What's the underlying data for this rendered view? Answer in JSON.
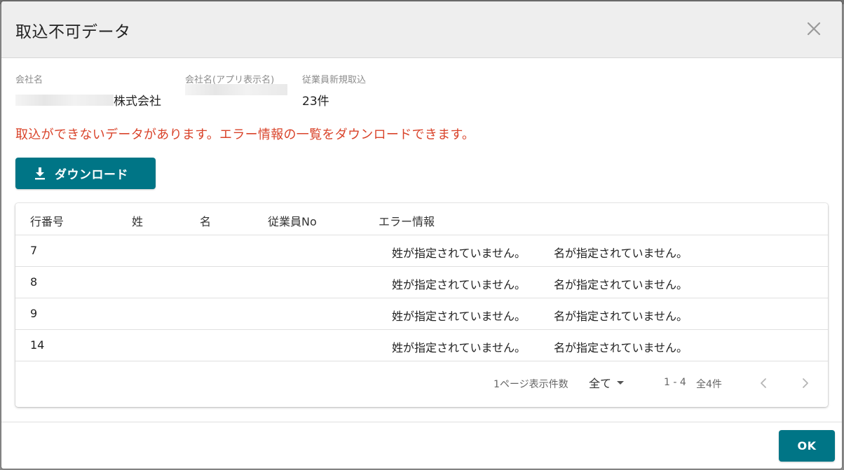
{
  "dialog": {
    "title": "取込不可データ",
    "close_icon": "close-icon"
  },
  "summary": {
    "company_name_label": "会社名",
    "company_name_suffix": "株式会社",
    "company_app_name_label": "会社名(アプリ表示名)",
    "new_employee_label": "従業員新規取込",
    "new_employee_value": "23件"
  },
  "error_message": "取込ができないデータがあります。エラー情報の一覧をダウンロードできます。",
  "download_button": {
    "label": "ダウンロード",
    "icon": "download-icon"
  },
  "table": {
    "columns": [
      "行番号",
      "姓",
      "名",
      "従業員No",
      "エラー情報"
    ],
    "rows": [
      {
        "row_no": "7",
        "last_name": "",
        "first_name": "",
        "employee_no": "",
        "error_1": "姓が指定されていません。",
        "error_2": "名が指定されていません。"
      },
      {
        "row_no": "8",
        "last_name": "",
        "first_name": "",
        "employee_no": "",
        "error_1": "姓が指定されていません。",
        "error_2": "名が指定されていません。"
      },
      {
        "row_no": "9",
        "last_name": "",
        "first_name": "",
        "employee_no": "",
        "error_1": "姓が指定されていません。",
        "error_2": "名が指定されていません。"
      },
      {
        "row_no": "14",
        "last_name": "",
        "first_name": "",
        "employee_no": "",
        "error_1": "姓が指定されていません。",
        "error_2": "名が指定されていません。"
      }
    ]
  },
  "pagination": {
    "per_page_label": "1ページ表示件数",
    "per_page_value": "全て",
    "range_text": "1 - 4",
    "total_text": "全4件",
    "prev_icon": "chevron-left-icon",
    "next_icon": "chevron-right-icon"
  },
  "actions": {
    "ok_label": "OK"
  },
  "colors": {
    "accent": "#007586",
    "error": "#d9432a",
    "header_bg": "#eeeeee"
  }
}
